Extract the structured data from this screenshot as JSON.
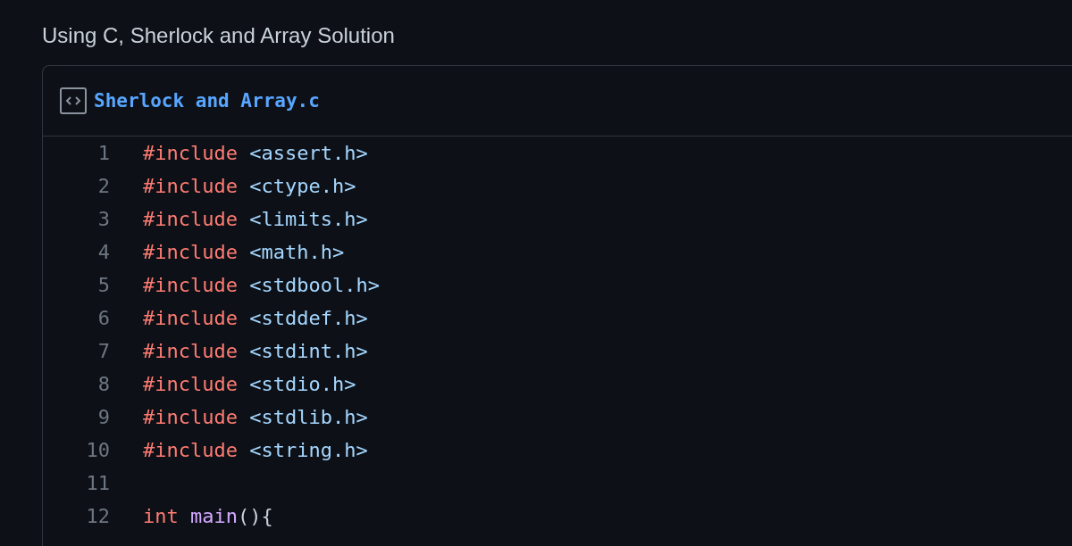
{
  "heading": "Using C, Sherlock and Array Solution",
  "file": {
    "name": "Sherlock and Array.c"
  },
  "code_lines": [
    {
      "number": "1",
      "tokens": [
        {
          "kind": "keyword",
          "text": "#include"
        },
        {
          "kind": "string",
          "text": "<assert.h>"
        }
      ]
    },
    {
      "number": "2",
      "tokens": [
        {
          "kind": "keyword",
          "text": "#include"
        },
        {
          "kind": "string",
          "text": "<ctype.h>"
        }
      ]
    },
    {
      "number": "3",
      "tokens": [
        {
          "kind": "keyword",
          "text": "#include"
        },
        {
          "kind": "string",
          "text": "<limits.h>"
        }
      ]
    },
    {
      "number": "4",
      "tokens": [
        {
          "kind": "keyword",
          "text": "#include"
        },
        {
          "kind": "string",
          "text": "<math.h>"
        }
      ]
    },
    {
      "number": "5",
      "tokens": [
        {
          "kind": "keyword",
          "text": "#include"
        },
        {
          "kind": "string",
          "text": "<stdbool.h>"
        }
      ]
    },
    {
      "number": "6",
      "tokens": [
        {
          "kind": "keyword",
          "text": "#include"
        },
        {
          "kind": "string",
          "text": "<stddef.h>"
        }
      ]
    },
    {
      "number": "7",
      "tokens": [
        {
          "kind": "keyword",
          "text": "#include"
        },
        {
          "kind": "string",
          "text": "<stdint.h>"
        }
      ]
    },
    {
      "number": "8",
      "tokens": [
        {
          "kind": "keyword",
          "text": "#include"
        },
        {
          "kind": "string",
          "text": "<stdio.h>"
        }
      ]
    },
    {
      "number": "9",
      "tokens": [
        {
          "kind": "keyword",
          "text": "#include"
        },
        {
          "kind": "string",
          "text": "<stdlib.h>"
        }
      ]
    },
    {
      "number": "10",
      "tokens": [
        {
          "kind": "keyword",
          "text": "#include"
        },
        {
          "kind": "string",
          "text": "<string.h>"
        }
      ]
    },
    {
      "number": "11"
    },
    {
      "number": "12",
      "tokens": [
        {
          "kind": "keyword",
          "text": "int"
        },
        {
          "kind": "function",
          "text": "main"
        },
        {
          "kind": "plain",
          "text": "(){",
          "joined": true
        }
      ]
    }
  ]
}
